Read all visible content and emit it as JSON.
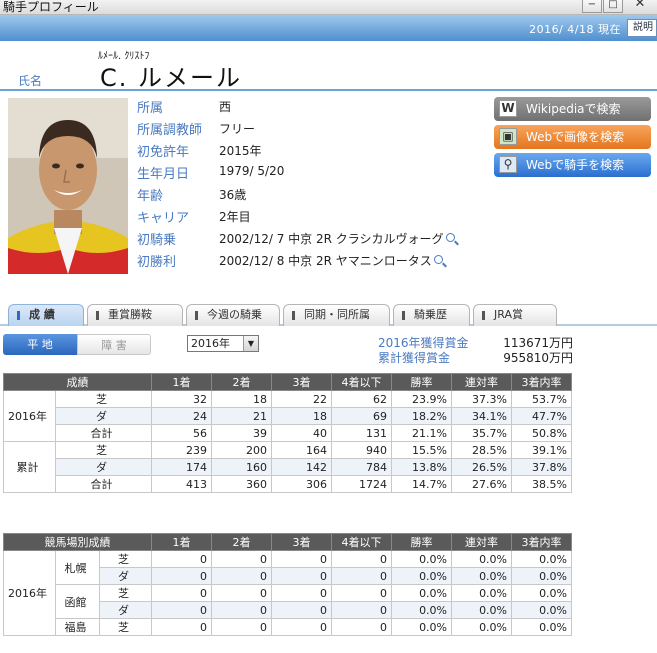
{
  "window": {
    "title": "騎手プロフィール",
    "min": "−",
    "max": "□",
    "close": "✕"
  },
  "datebar": {
    "date": "2016/ 4/18 現在",
    "help": "説明"
  },
  "header": {
    "name_label": "氏名",
    "kana": "ﾙﾒｰﾙ. ｸﾘｽﾄﾌ",
    "name": "C. ルメール"
  },
  "profile": {
    "rows": [
      {
        "label": "所属",
        "value": "西"
      },
      {
        "label": "所属調教師",
        "value": "フリー"
      },
      {
        "label": "初免許年",
        "value": "2015年"
      },
      {
        "label": "生年月日",
        "value": "1979/ 5/20"
      },
      {
        "label": "年齢",
        "value": "36歳"
      },
      {
        "label": "キャリア",
        "value": "2年目"
      },
      {
        "label": "初騎乗",
        "value": "2002/12/ 7 中京 2R クラシカルヴォーグ"
      },
      {
        "label": "初勝利",
        "value": "2002/12/ 8 中京 2R ヤマニンロータス"
      }
    ]
  },
  "search_buttons": [
    {
      "label": "Wikipediaで検索",
      "icon": "W",
      "color": "gray"
    },
    {
      "label": "Webで画像を検索",
      "icon": "image-icon",
      "color": "orange"
    },
    {
      "label": "Webで騎手を検索",
      "icon": "search-icon",
      "color": "blue"
    }
  ],
  "tabs": [
    "成 績",
    "重賞勝鞍",
    "今週の騎乗",
    "同期・同所属",
    "騎乗歴",
    "JRA賞"
  ],
  "segments": {
    "flat": "平 地",
    "jump": "障 害"
  },
  "year_select": {
    "value": "2016年"
  },
  "prize": {
    "year_label": "2016年獲得賞金",
    "year_value": "113671万円",
    "total_label": "累計獲得賞金",
    "total_value": "955810万円"
  },
  "stats_table": {
    "headers": [
      "成績",
      "1着",
      "2着",
      "3着",
      "4着以下",
      "勝率",
      "連対率",
      "3着内率"
    ],
    "groups": [
      {
        "label": "2016年",
        "rows": [
          {
            "surface": "芝",
            "cells": [
              "32",
              "18",
              "22",
              "62",
              "23.9%",
              "37.3%",
              "53.7%"
            ]
          },
          {
            "surface": "ダ",
            "cells": [
              "24",
              "21",
              "18",
              "69",
              "18.2%",
              "34.1%",
              "47.7%"
            ]
          },
          {
            "surface": "合計",
            "cells": [
              "56",
              "39",
              "40",
              "131",
              "21.1%",
              "35.7%",
              "50.8%"
            ]
          }
        ]
      },
      {
        "label": "累計",
        "rows": [
          {
            "surface": "芝",
            "cells": [
              "239",
              "200",
              "164",
              "940",
              "15.5%",
              "28.5%",
              "39.1%"
            ]
          },
          {
            "surface": "ダ",
            "cells": [
              "174",
              "160",
              "142",
              "784",
              "13.8%",
              "26.5%",
              "37.8%"
            ]
          },
          {
            "surface": "合計",
            "cells": [
              "413",
              "360",
              "306",
              "1724",
              "14.7%",
              "27.6%",
              "38.5%"
            ]
          }
        ]
      }
    ]
  },
  "course_table": {
    "headers": [
      "競馬場別成績",
      "1着",
      "2着",
      "3着",
      "4着以下",
      "勝率",
      "連対率",
      "3着内率"
    ],
    "year": "2016年",
    "courses": [
      {
        "name": "札幌",
        "rows": [
          {
            "surface": "芝",
            "cells": [
              "0",
              "0",
              "0",
              "0",
              "0.0%",
              "0.0%",
              "0.0%"
            ]
          },
          {
            "surface": "ダ",
            "cells": [
              "0",
              "0",
              "0",
              "0",
              "0.0%",
              "0.0%",
              "0.0%"
            ]
          }
        ]
      },
      {
        "name": "函館",
        "rows": [
          {
            "surface": "芝",
            "cells": [
              "0",
              "0",
              "0",
              "0",
              "0.0%",
              "0.0%",
              "0.0%"
            ]
          },
          {
            "surface": "ダ",
            "cells": [
              "0",
              "0",
              "0",
              "0",
              "0.0%",
              "0.0%",
              "0.0%"
            ]
          }
        ]
      },
      {
        "name": "福島",
        "rows": [
          {
            "surface": "芝",
            "cells": [
              "0",
              "0",
              "0",
              "0",
              "0.0%",
              "0.0%",
              "0.0%"
            ]
          }
        ]
      }
    ]
  }
}
